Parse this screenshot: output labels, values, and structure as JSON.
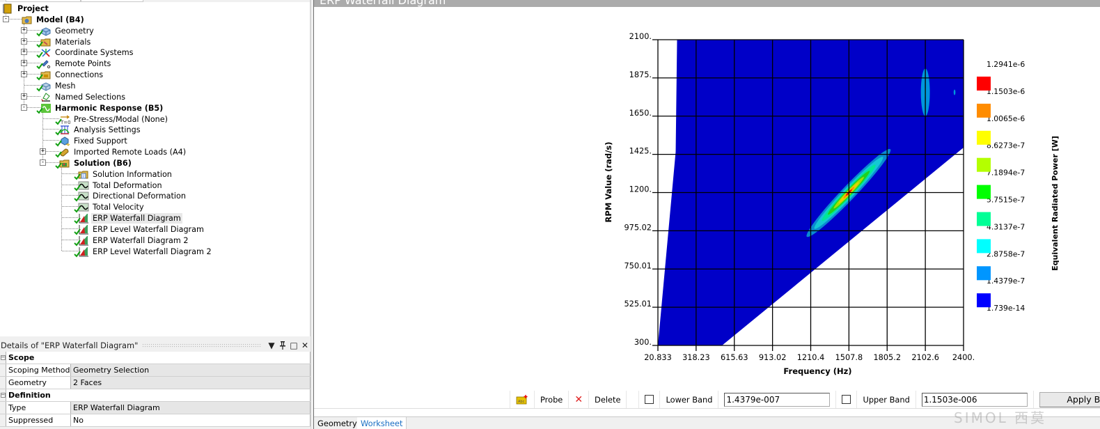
{
  "tree": {
    "root": {
      "label": "Project"
    },
    "items": [
      {
        "label": "Model (B4)",
        "bold": true,
        "level": 1,
        "expander": "minus",
        "icon": "model-folder-icon",
        "check": false
      },
      {
        "label": "Geometry",
        "level": 2,
        "expander": "plus",
        "icon": "geometry-icon",
        "check": true
      },
      {
        "label": "Materials",
        "level": 2,
        "expander": "plus",
        "icon": "materials-icon",
        "check": true
      },
      {
        "label": "Coordinate Systems",
        "level": 2,
        "expander": "plus",
        "icon": "coordinate-systems-icon",
        "check": true
      },
      {
        "label": "Remote Points",
        "level": 2,
        "expander": "plus",
        "icon": "remote-points-icon",
        "check": true
      },
      {
        "label": "Connections",
        "level": 2,
        "expander": "plus",
        "icon": "connections-icon",
        "check": true
      },
      {
        "label": "Mesh",
        "level": 2,
        "expander": "none",
        "icon": "mesh-icon",
        "check": true
      },
      {
        "label": "Named Selections",
        "level": 2,
        "expander": "plus",
        "icon": "named-selections-icon",
        "check": false
      },
      {
        "label": "Harmonic Response (B5)",
        "bold": true,
        "level": 2,
        "expander": "minus",
        "icon": "harmonic-response-icon",
        "check": true
      },
      {
        "label": "Pre-Stress/Modal (None)",
        "level": 3,
        "expander": "none",
        "icon": "pre-stress-icon",
        "check": true
      },
      {
        "label": "Analysis Settings",
        "level": 3,
        "expander": "none",
        "icon": "analysis-settings-icon",
        "check": true
      },
      {
        "label": "Fixed Support",
        "level": 3,
        "expander": "none",
        "icon": "fixed-support-icon",
        "check": true
      },
      {
        "label": "Imported Remote Loads (A4)",
        "level": 3,
        "expander": "plus",
        "icon": "imported-loads-icon",
        "check": true
      },
      {
        "label": "Solution (B6)",
        "bold": true,
        "level": 3,
        "expander": "minus",
        "icon": "solution-icon",
        "check": true
      },
      {
        "label": "Solution Information",
        "level": 4,
        "expander": "none",
        "icon": "solution-information-icon",
        "check": true
      },
      {
        "label": "Total Deformation",
        "level": 4,
        "expander": "none",
        "icon": "deformation-result-icon",
        "check": true
      },
      {
        "label": "Directional Deformation",
        "level": 4,
        "expander": "none",
        "icon": "deformation-result-icon",
        "check": true
      },
      {
        "label": "Total Velocity",
        "level": 4,
        "expander": "none",
        "icon": "deformation-result-icon",
        "check": true
      },
      {
        "label": "ERP Waterfall Diagram",
        "level": 4,
        "expander": "none",
        "icon": "waterfall-diagram-icon",
        "check": true,
        "selected": true
      },
      {
        "label": "ERP Level Waterfall Diagram",
        "level": 4,
        "expander": "none",
        "icon": "waterfall-diagram-icon",
        "check": true
      },
      {
        "label": "ERP Waterfall Diagram 2",
        "level": 4,
        "expander": "none",
        "icon": "waterfall-diagram-icon",
        "check": true
      },
      {
        "label": "ERP Level Waterfall Diagram 2",
        "level": 4,
        "expander": "none",
        "icon": "waterfall-diagram-icon",
        "check": true
      }
    ]
  },
  "details": {
    "title": "Details of \"ERP Waterfall Diagram\"",
    "buttons": {
      "dropdown": "▾",
      "pin": "0",
      "maximize": "□",
      "close": "✕"
    },
    "groups": [
      {
        "name": "Scope",
        "rows": [
          {
            "key": "Scoping Method",
            "value": "Geometry Selection"
          },
          {
            "key": "Geometry",
            "value": "2 Faces"
          }
        ]
      },
      {
        "name": "Definition",
        "rows": [
          {
            "key": "Type",
            "value": "ERP Waterfall Diagram"
          },
          {
            "key": "Suppressed",
            "value": "No"
          }
        ]
      }
    ]
  },
  "main": {
    "title": "ERP Waterfall Diagram"
  },
  "toolbar": {
    "probe_label": "Probe",
    "delete_label": "Delete",
    "lower_band_label": "Lower Band",
    "lower_band_value": "1.4379e-007",
    "lower_band_checked": false,
    "upper_band_label": "Upper Band",
    "upper_band_value": "1.1503e-006",
    "upper_band_checked": false,
    "apply_label": "Apply Ba"
  },
  "tabs": [
    {
      "label": "Geometry",
      "active": false
    },
    {
      "label": "Worksheet",
      "active": true
    }
  ],
  "watermark": "SIMOL 西莫",
  "chart_data": {
    "type": "heatmap",
    "title": "",
    "xlabel": "Frequency (Hz)",
    "ylabel": "RPM Value (rad/s)",
    "xlim": [
      20.833,
      2400
    ],
    "ylim": [
      300,
      2100
    ],
    "x_ticks": [
      "20.833",
      "318.23",
      "615.63",
      "913.02",
      "1210.4",
      "1507.8",
      "1805.2",
      "2102.6",
      "2400."
    ],
    "y_ticks": [
      "300.",
      "525.01",
      "750.01",
      "975.02",
      "1200.",
      "1425.",
      "1650.",
      "1875.",
      "2100."
    ],
    "grid": true,
    "colorbar": {
      "label": "Equivalent Radiated Power [W]",
      "placement": "right",
      "levels": [
        "1.2941e-6",
        "1.1503e-6",
        "1.0065e-6",
        "8.6273e-7",
        "7.1894e-7",
        "5.7515e-7",
        "4.3137e-7",
        "2.8758e-7",
        "1.4379e-7",
        "1.739e-14"
      ],
      "colors": [
        "#ff0000",
        "#ff8c00",
        "#ffff00",
        "#b4ff00",
        "#00ff00",
        "#00ff96",
        "#00ffff",
        "#0096ff",
        "#0000ff"
      ]
    },
    "domain_region": {
      "description": "Valid data region bounded by lines (freq, rpm)",
      "left_edge": [
        [
          20.833,
          300
        ],
        [
          170,
          2100
        ]
      ],
      "top_edge_right_end": [
        2400,
        2100
      ],
      "lower_right_edge": [
        [
          520,
          300
        ],
        [
          2400,
          1465
        ]
      ],
      "background_value": "1.739e-14",
      "background_color": "#0000c8"
    },
    "hotspots": [
      {
        "name": "main-resonance-band",
        "center": [
          1507.8,
          1200
        ],
        "from": [
          1180,
          940
        ],
        "to": [
          1830,
          1455
        ],
        "peak_value": "1.2941e-6",
        "peak_color": "#ff0000"
      },
      {
        "name": "upper-resonance",
        "center": [
          2102.6,
          1790
        ],
        "half_width_freq": 35,
        "half_height_rpm": 140,
        "value_band": "1.4379e-7",
        "color": "#0096dc"
      },
      {
        "name": "small-spot",
        "center": [
          2330,
          1790
        ],
        "value_band": "1.4379e-7",
        "color": "#0096dc"
      }
    ]
  }
}
